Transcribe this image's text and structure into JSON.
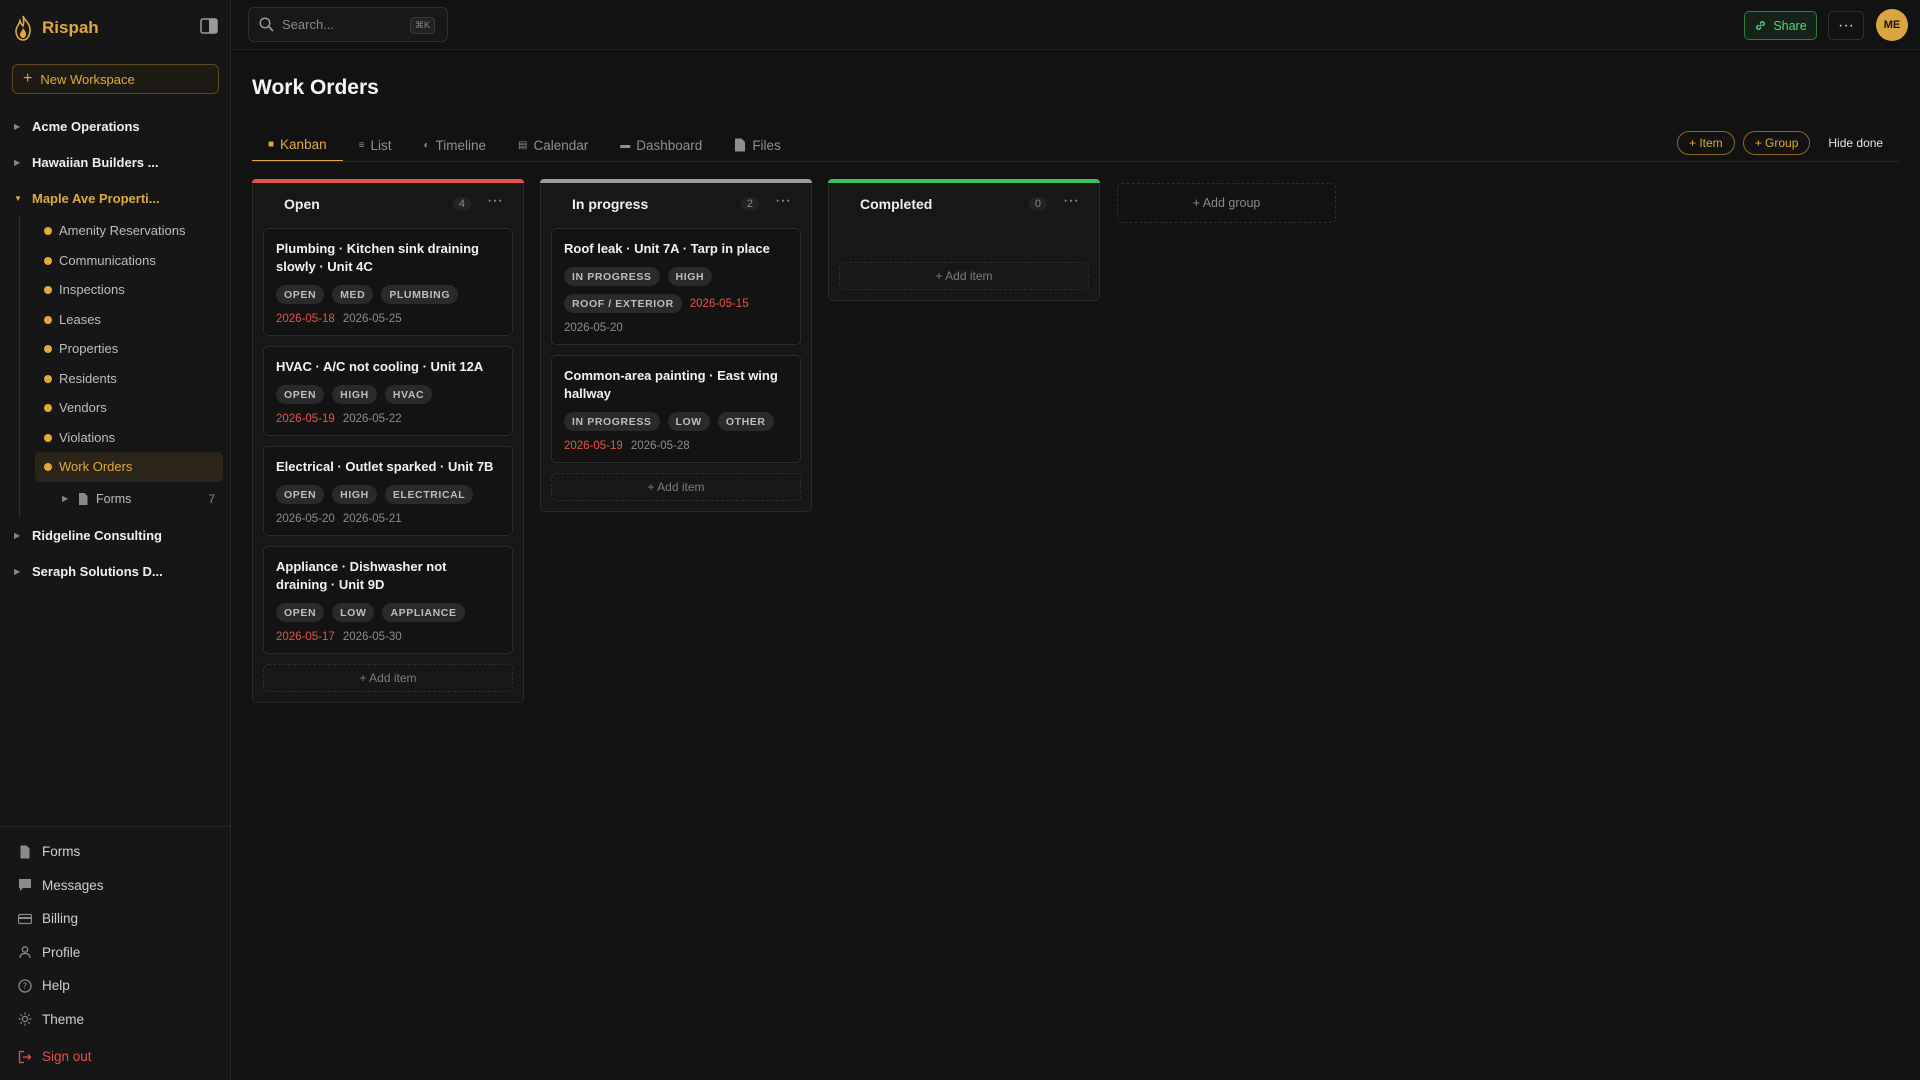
{
  "brand": {
    "name": "Rispah"
  },
  "sidebar": {
    "new_workspace": "New Workspace",
    "workspaces": [
      {
        "label": "Acme Operations"
      },
      {
        "label": "Hawaiian Builders ..."
      },
      {
        "label": "Maple Ave Properti..."
      },
      {
        "label": "Ridgeline Consulting"
      },
      {
        "label": "Seraph Solutions D..."
      }
    ],
    "sub_items": [
      {
        "label": "Amenity Reservations"
      },
      {
        "label": "Communications"
      },
      {
        "label": "Inspections"
      },
      {
        "label": "Leases"
      },
      {
        "label": "Properties"
      },
      {
        "label": "Residents"
      },
      {
        "label": "Vendors"
      },
      {
        "label": "Violations"
      },
      {
        "label": "Work Orders"
      }
    ],
    "folder": {
      "label": "Forms",
      "count": "7"
    },
    "footer": [
      {
        "label": "Forms"
      },
      {
        "label": "Messages"
      },
      {
        "label": "Billing"
      },
      {
        "label": "Profile"
      },
      {
        "label": "Help"
      },
      {
        "label": "Theme"
      },
      {
        "label": "Sign out"
      }
    ]
  },
  "topbar": {
    "search_placeholder": "Search...",
    "search_shortcut": "⌘K",
    "share": "Share",
    "more": "···",
    "avatar": "ME"
  },
  "page": {
    "title": "Work Orders",
    "tabs": [
      {
        "label": "Kanban"
      },
      {
        "label": "List"
      },
      {
        "label": "Timeline"
      },
      {
        "label": "Calendar"
      },
      {
        "label": "Dashboard"
      },
      {
        "label": "Files"
      }
    ],
    "actions": {
      "item": "+ Item",
      "group": "+ Group",
      "hide_done": "Hide done"
    }
  },
  "colors": {
    "accent": "#e0a93a",
    "open": "#e5534b",
    "in_progress": "#9a9a9a",
    "completed": "#3fbf5a"
  },
  "board": {
    "add_item": "+ Add item",
    "add_group": "+ Add group",
    "columns": [
      {
        "title": "Open",
        "count": "4",
        "cards": [
          {
            "title": "Plumbing · Kitchen sink draining slowly · Unit 4C",
            "tags": [
              "OPEN",
              "MED",
              "PLUMBING"
            ],
            "due": "2026-05-18",
            "date2": "2026-05-25"
          },
          {
            "title": "HVAC · A/C not cooling · Unit 12A",
            "tags": [
              "OPEN",
              "HIGH",
              "HVAC"
            ],
            "due": "2026-05-19",
            "date2": "2026-05-22"
          },
          {
            "title": "Electrical · Outlet sparked · Unit 7B",
            "tags": [
              "OPEN",
              "HIGH",
              "ELECTRICAL"
            ],
            "date1": "2026-05-20",
            "date2": "2026-05-21"
          },
          {
            "title": "Appliance · Dishwasher not draining · Unit 9D",
            "tags": [
              "OPEN",
              "LOW",
              "APPLIANCE"
            ],
            "due": "2026-05-17",
            "date2": "2026-05-30"
          }
        ]
      },
      {
        "title": "In progress",
        "count": "2",
        "cards": [
          {
            "title": "Roof leak · Unit 7A · Tarp in place",
            "tags": [
              "IN PROGRESS",
              "HIGH",
              "ROOF / EXTERIOR"
            ],
            "due": "2026-05-15",
            "date2": "2026-05-20"
          },
          {
            "title": "Common-area painting · East wing hallway",
            "tags": [
              "IN PROGRESS",
              "LOW",
              "OTHER"
            ],
            "due": "2026-05-19",
            "date2": "2026-05-28"
          }
        ]
      },
      {
        "title": "Completed",
        "count": "0",
        "cards": []
      }
    ]
  }
}
